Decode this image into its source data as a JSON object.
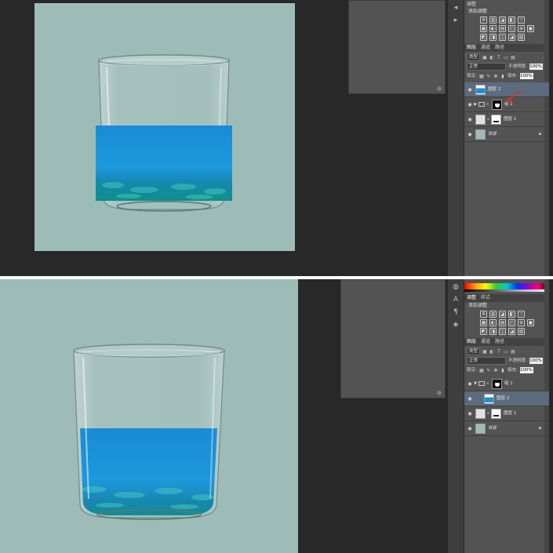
{
  "colors": {
    "canvas_bg": "#9dbcb8",
    "workspace_bg": "#282828",
    "panel_bg": "#535353",
    "water": "#1d8fd6",
    "selected_layer": "#5c6b7e",
    "annotation_arrow": "#d9302c"
  },
  "top": {
    "adjustments": {
      "tab": "调整",
      "title": "添加调整",
      "row1": [
        "✲",
        "▥",
        "◪",
        "◧",
        "▽"
      ],
      "row2": [
        "▦",
        "◐",
        "▤",
        "◰",
        "⊕",
        "▣"
      ],
      "row3": [
        "◩",
        "◨",
        "◫",
        "◪",
        "▧"
      ]
    },
    "layers": {
      "tabs": [
        "图层",
        "通道",
        "路径"
      ],
      "kind": "类型",
      "blend": "正常",
      "opacity_label": "不透明度:",
      "opacity": "100%",
      "lock_label": "锁定:",
      "fill_label": "填充:",
      "fill": "100%",
      "items": [
        {
          "name": "图层 2",
          "selected": true
        },
        {
          "name": "组 1",
          "group": true
        },
        {
          "name": "图层 1"
        },
        {
          "name": "背景",
          "italic": true,
          "locked": true
        }
      ]
    }
  },
  "bottom": {
    "adjustments": {
      "tab": "调整",
      "tab2": "样式",
      "title": "添加调整",
      "row1": [
        "✲",
        "▥",
        "◪",
        "◧",
        "▽"
      ],
      "row2": [
        "▦",
        "◐",
        "▤",
        "◰",
        "⊕",
        "▣"
      ],
      "row3": [
        "◩",
        "◨",
        "◫",
        "◪",
        "▧"
      ]
    },
    "layers": {
      "tabs": [
        "图层",
        "通道",
        "路径"
      ],
      "kind": "类型",
      "blend": "正常",
      "opacity_label": "不透明度:",
      "opacity": "100%",
      "lock_label": "锁定:",
      "fill_label": "填充:",
      "fill": "100%",
      "items": [
        {
          "name": "组 1",
          "group": true,
          "expanded": true
        },
        {
          "name": "图层 2",
          "selected": true,
          "clipped": true
        },
        {
          "name": "图层 1"
        },
        {
          "name": "背景",
          "italic": true,
          "locked": true
        }
      ]
    }
  }
}
